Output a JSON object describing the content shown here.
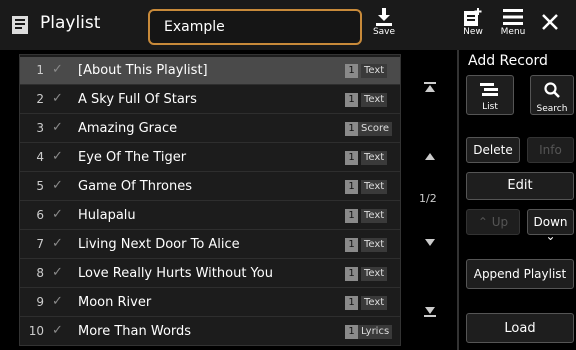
{
  "header": {
    "title": "Playlist",
    "name_value": "Example",
    "save_label": "Save",
    "new_label": "New",
    "menu_label": "Menu"
  },
  "list": {
    "rows": [
      {
        "num": "1",
        "name": "[About This Playlist]",
        "count": "1",
        "type": "Text"
      },
      {
        "num": "2",
        "name": "A Sky Full Of Stars",
        "count": "1",
        "type": "Text"
      },
      {
        "num": "3",
        "name": "Amazing Grace",
        "count": "1",
        "type": "Score"
      },
      {
        "num": "4",
        "name": "Eye Of The Tiger",
        "count": "1",
        "type": "Text"
      },
      {
        "num": "5",
        "name": "Game Of Thrones",
        "count": "1",
        "type": "Text"
      },
      {
        "num": "6",
        "name": "Hulapalu",
        "count": "1",
        "type": "Text"
      },
      {
        "num": "7",
        "name": "Living Next Door To Alice",
        "count": "1",
        "type": "Text"
      },
      {
        "num": "8",
        "name": "Love Really Hurts Without You",
        "count": "1",
        "type": "Text"
      },
      {
        "num": "9",
        "name": "Moon River",
        "count": "1",
        "type": "Text"
      },
      {
        "num": "10",
        "name": "More Than Words",
        "count": "1",
        "type": "Lyrics"
      }
    ],
    "check_glyph": "✓",
    "page_indicator": "1/2"
  },
  "right_panel": {
    "add_record_label": "Add Record",
    "list_label": "List",
    "search_label": "Search",
    "delete_label": "Delete",
    "info_label": "Info",
    "edit_label": "Edit",
    "up_label": "Up",
    "down_label": "Down",
    "append_label": "Append Playlist",
    "load_label": "Load"
  },
  "colors": {
    "accent": "#c88a3a",
    "selected_row": "#4a4a4a"
  }
}
